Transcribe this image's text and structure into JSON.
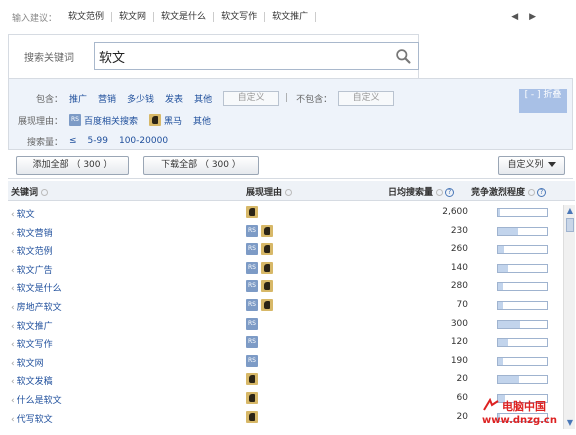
{
  "suggestions": {
    "label": "输入建议：",
    "items": [
      "软文范例",
      "软文网",
      "软文是什么",
      "软文写作",
      "软文推广"
    ],
    "nav": "◀ ▶"
  },
  "search": {
    "label": "搜索关键词",
    "value": "软文",
    "placeholder": ""
  },
  "filters": {
    "include_label": "包含：",
    "include_options": [
      "推广",
      "营销",
      "多少钱",
      "发表",
      "其他"
    ],
    "custom_label": "自定义",
    "exclude_label": "不包含：",
    "exclude_custom_label": "自定义",
    "reason_label": "展现理由：",
    "reason_rs_icon": "RS",
    "reason_baidu": "百度相关搜索",
    "reason_darkhorse": "黑马",
    "reason_other": "其他",
    "volume_label": "搜索量：",
    "volume_options": [
      "≤",
      "5-99",
      "100-20000"
    ],
    "collapse_label": "[ - ] 折叠"
  },
  "actions": {
    "add_all": "添加全部 （ 300 ）",
    "download_all": "下载全部 （ 300 ）",
    "custom_columns": "自定义列"
  },
  "table": {
    "headers": {
      "keyword": "关键词",
      "reason": "展现理由",
      "daily_volume": "日均搜索量",
      "competition": "竞争激烈程度"
    },
    "rows": [
      {
        "keyword": "软文",
        "reasons": [
          "horse"
        ],
        "volume": "2,600",
        "competition": 0.05
      },
      {
        "keyword": "软文营销",
        "reasons": [
          "rs",
          "horse"
        ],
        "volume": "230",
        "competition": 0.4
      },
      {
        "keyword": "软文范例",
        "reasons": [
          "rs",
          "horse"
        ],
        "volume": "260",
        "competition": 0.12
      },
      {
        "keyword": "软文广告",
        "reasons": [
          "rs",
          "horse"
        ],
        "volume": "140",
        "competition": 0.2
      },
      {
        "keyword": "软文是什么",
        "reasons": [
          "rs",
          "horse"
        ],
        "volume": "280",
        "competition": 0.1
      },
      {
        "keyword": "房地产软文",
        "reasons": [
          "rs",
          "horse"
        ],
        "volume": "70",
        "competition": 0.1
      },
      {
        "keyword": "软文推广",
        "reasons": [
          "rs"
        ],
        "volume": "300",
        "competition": 0.45
      },
      {
        "keyword": "软文写作",
        "reasons": [
          "rs"
        ],
        "volume": "120",
        "competition": 0.2
      },
      {
        "keyword": "软文网",
        "reasons": [
          "rs"
        ],
        "volume": "190",
        "competition": 0.1
      },
      {
        "keyword": "软文发稿",
        "reasons": [
          "horse"
        ],
        "volume": "20",
        "competition": 0.42
      },
      {
        "keyword": "什么是软文",
        "reasons": [
          "horse"
        ],
        "volume": "60",
        "competition": 0.15
      },
      {
        "keyword": "代写软文",
        "reasons": [
          "horse"
        ],
        "volume": "20",
        "competition": 0.05
      }
    ]
  },
  "watermark": {
    "line1": "电脑中国",
    "line2": "www.dnzg.cn"
  },
  "colors": {
    "link": "#1f4f9c",
    "panel_bg": "#eef3fa",
    "bar_fill": "#c2d4ec",
    "watermark": "#dd2222"
  }
}
